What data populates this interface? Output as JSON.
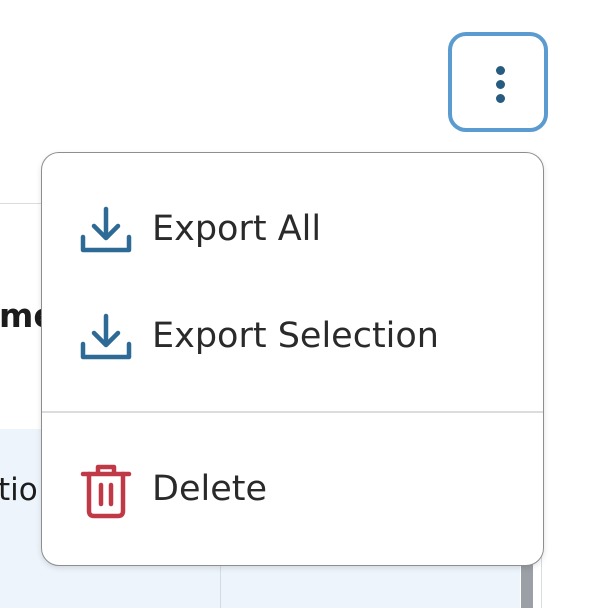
{
  "table": {
    "header_fragment": "me",
    "row_fragment": "tio"
  },
  "toolbar": {
    "more_icon": "kebab-vertical-icon",
    "more_color": "#275b80",
    "focus_ring_color": "#5b9bd0"
  },
  "menu": {
    "items": [
      {
        "label": "Export All",
        "icon": "download-icon",
        "color": "#2e6a96"
      },
      {
        "label": "Export Selection",
        "icon": "download-icon",
        "color": "#2e6a96"
      },
      {
        "label": "Delete",
        "icon": "trash-icon",
        "color": "#bf3946"
      }
    ]
  }
}
